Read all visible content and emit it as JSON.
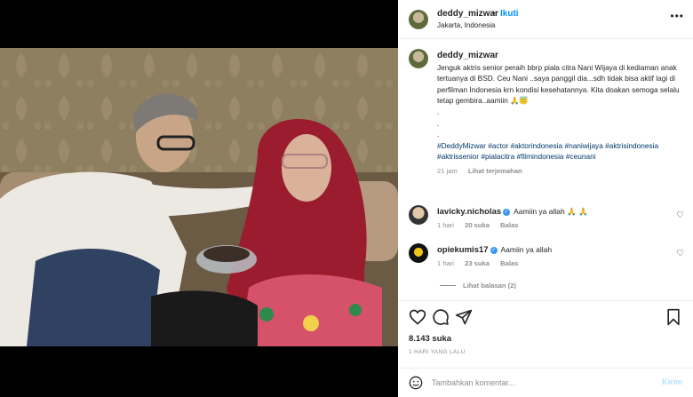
{
  "post": {
    "username": "deddy_mizwar",
    "separator": "•",
    "follow_label": "Ikuti",
    "location": "Jakarta, Indonesia",
    "more_label": "•••"
  },
  "caption": {
    "username": "deddy_mizwar",
    "text": "Jenguk aktris senior peraih bbrp piala citra Nani Wijaya di kediaman anak tertuanya di BSD. Ceu Nani ..saya panggil dia...sdh tidak bisa aktif lagi di perfilman Indonesia krn kondisi kesehatannya. Kita doakan semoga selalu tetap gembira..aamiin 🙏😇",
    "dots": [
      ".",
      ".",
      "."
    ],
    "hashtags": [
      "#DeddyMizwar",
      "#actor",
      "#aktorindonesia",
      "#naniwijaya",
      "#aktrisindonesia",
      "#aktrissenior",
      "#pialacitra",
      "#filmindonesia",
      "#ceunani"
    ],
    "time": "21 jam",
    "translate_label": "Lihat terjemahan"
  },
  "comments": [
    {
      "username": "lavicky.nicholas",
      "verified": "✓",
      "text": "Aamiin ya allah 🙏 🙏",
      "time": "1 hari",
      "likes": "20 suka",
      "reply": "Balas"
    },
    {
      "username": "opiekumis17",
      "verified": "✓",
      "text": "Aamiin ya allah",
      "time": "1 hari",
      "likes": "23 suka",
      "reply": "Balas"
    }
  ],
  "view_replies": "Lihat balasan (2)",
  "likes_count": "8.143 suka",
  "posted_ago": "1 HARI YANG LALU",
  "add_comment": {
    "placeholder": "Tambahkan komentar...",
    "post_label": "Kirim"
  },
  "icons": {
    "heart": "heart-icon",
    "comment": "comment-icon",
    "share": "share-icon",
    "save": "bookmark-icon",
    "emoji": "emoji-icon"
  },
  "colors": {
    "link": "#0095f6",
    "hashtag": "#00376b",
    "muted": "#8e8e8e",
    "verified": "#3897f0"
  }
}
